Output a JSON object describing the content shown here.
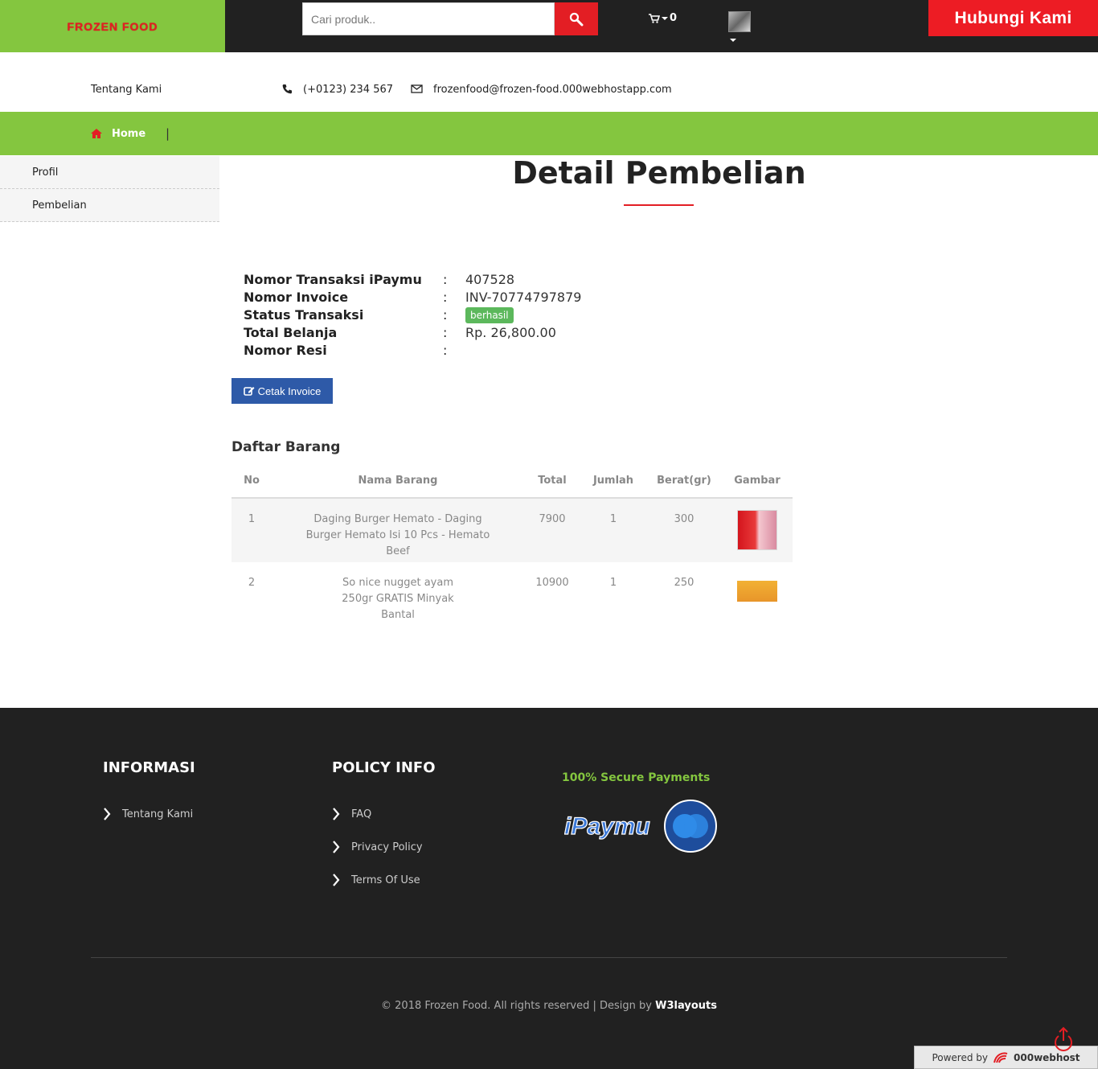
{
  "header": {
    "logo": "FROZEN FOOD",
    "search_placeholder": "Cari produk..",
    "cart_count": "0",
    "contact_button": "Hubungi Kami"
  },
  "info_bar": {
    "about": "Tentang Kami",
    "phone": "(+0123) 234 567",
    "email": "frozenfood@frozen-food.000webhostapp.com"
  },
  "nav": {
    "home": "Home",
    "separator": "|"
  },
  "sidebar": {
    "items": [
      {
        "label": "Profil"
      },
      {
        "label": "Pembelian"
      }
    ]
  },
  "page": {
    "title": "Detail Pembelian"
  },
  "details": {
    "transaction_label": "Nomor Transaksi iPaymu",
    "transaction_value": "407528",
    "invoice_label": "Nomor Invoice",
    "invoice_value": "INV-70774797879",
    "status_label": "Status Transaksi",
    "status_value": "berhasil",
    "total_label": "Total Belanja",
    "total_value": "Rp. 26,800.00",
    "resi_label": "Nomor Resi",
    "resi_value": "",
    "colon": ":"
  },
  "print_button": "Cetak Invoice",
  "items_section": {
    "title": "Daftar Barang",
    "headers": [
      "No",
      "Nama Barang",
      "Total",
      "Jumlah",
      "Berat(gr)",
      "Gambar"
    ],
    "rows": [
      {
        "no": "1",
        "name": "Daging Burger Hemato - Daging Burger Hemato Isi 10 Pcs - Hemato Beef",
        "total": "7900",
        "qty": "1",
        "weight": "300"
      },
      {
        "no": "2",
        "name": "So nice nugget ayam 250gr GRATIS Minyak Bantal",
        "total": "10900",
        "qty": "1",
        "weight": "250"
      }
    ]
  },
  "footer": {
    "info_heading": "INFORMASI",
    "info_links": [
      "Tentang Kami"
    ],
    "policy_heading": "POLICY INFO",
    "policy_links": [
      "FAQ",
      "Privacy Policy",
      "Terms Of Use"
    ],
    "secure_text": "100% Secure Payments",
    "payment_logo_text": "iPaymu",
    "copyright": "© 2018 Frozen Food. All rights reserved | Design by",
    "designer": "W3layouts",
    "powered_by": "Powered by",
    "host": "000webhost"
  },
  "colors": {
    "brand_green": "#84c63f",
    "brand_red": "#e31e24",
    "dark": "#212121",
    "button_blue": "#2e5aa8",
    "success": "#5cb85c"
  }
}
